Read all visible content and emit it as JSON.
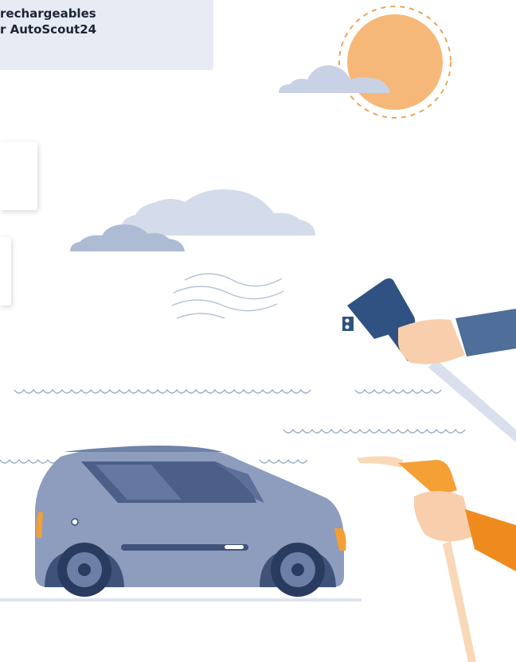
{
  "banner": {
    "line1": "rechargeables",
    "line2": "r AutoScout24"
  },
  "colors": {
    "sun": "#f6b878",
    "sun_ring": "#f0a35a",
    "cloud": "#c9d2e4",
    "car_body": "#8e9dbd",
    "car_dark": "#3f5279",
    "charger_blue": "#2f5283",
    "pump_orange": "#f4a035",
    "sleeve_orange": "#ee8a1e",
    "skin": "#f9ceac"
  },
  "icons": [
    "sun-icon",
    "cloud-icon",
    "car-icon",
    "ev-charger-icon",
    "fuel-nozzle-icon",
    "wind-icon"
  ]
}
